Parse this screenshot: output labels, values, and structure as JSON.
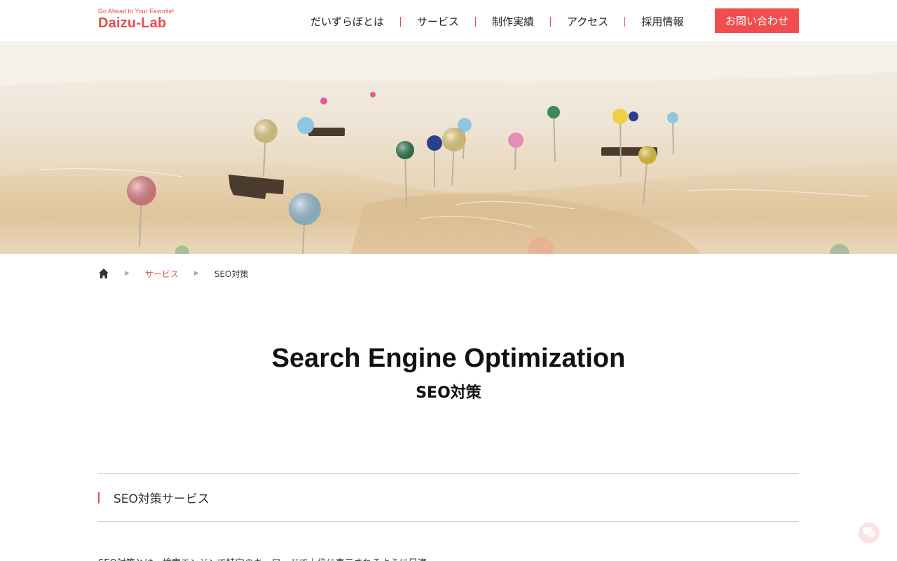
{
  "header": {
    "logo_tagline": "Go Ahead to Your Favorite!",
    "logo_name": "Daizu-Lab",
    "nav": [
      "だいずらぼとは",
      "サービス",
      "制作実績",
      "アクセス",
      "採用情報"
    ],
    "contact_label": "お問い合わせ"
  },
  "hero": {
    "icon": "map-pins-photo"
  },
  "breadcrumb": {
    "home_icon": "home-icon",
    "items": [
      "サービス",
      "SEO対策"
    ]
  },
  "page": {
    "title_en": "Search Engine Optimization",
    "title_ja": "SEO対策",
    "section_title": "SEO対策サービス",
    "body_text": "SEO対策とは、検索エンジンで特定のキーワードで上位に表示されるように目適..."
  },
  "colors": {
    "accent": "#e84c4c",
    "button": "#f04e4e"
  },
  "chat": {
    "icon": "chat-bubbles-icon"
  }
}
